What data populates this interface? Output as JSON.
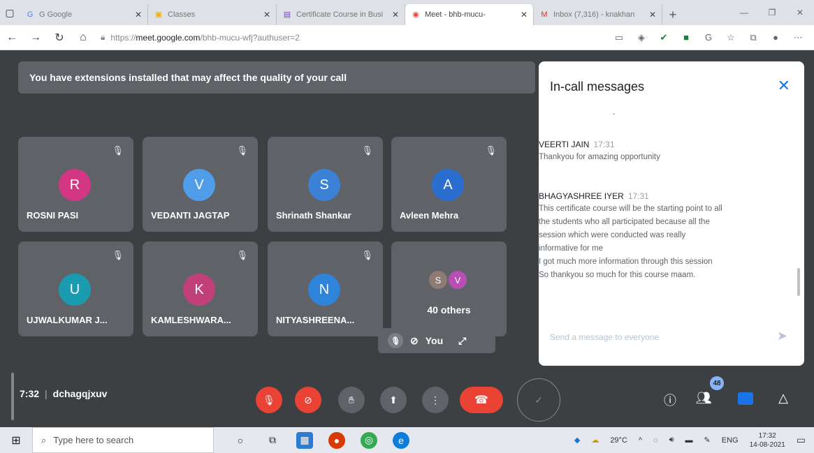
{
  "browser": {
    "tabs": [
      {
        "title": "G Google",
        "icon": "google-icon",
        "active": false
      },
      {
        "title": "Classes",
        "icon": "classroom-icon",
        "active": false
      },
      {
        "title": "Certificate Course in Busi",
        "icon": "forms-icon",
        "active": false
      },
      {
        "title": "Meet - bhb-mucu-",
        "icon": "meet-icon",
        "active": true
      },
      {
        "title": "Inbox (7,316) - knakhan",
        "icon": "gmail-icon",
        "active": false
      }
    ],
    "url_prefix": "https://",
    "url_host": "meet.google.com",
    "url_path": "/bhb-mucu-wfj?authuser=2"
  },
  "meet": {
    "banner": "You have extensions installed that may affect the quality of your call",
    "participants": [
      {
        "initial": "R",
        "name": "ROSNI PASI",
        "color": "#d33682"
      },
      {
        "initial": "V",
        "name": "VEDANTI JAGTAP",
        "color": "#4f9de8"
      },
      {
        "initial": "S",
        "name": "Shrinath Shankar",
        "color": "#3b82d6"
      },
      {
        "initial": "A",
        "name": "Avleen Mehra",
        "color": "#2a6fd0"
      },
      {
        "initial": "U",
        "name": "UJWALKUMAR J...",
        "color": "#1a9bb0"
      },
      {
        "initial": "K",
        "name": "KAMLESHWARA...",
        "color": "#c2407a"
      },
      {
        "initial": "N",
        "name": "NITYASHREENA...",
        "color": "#2d84d8"
      }
    ],
    "others": {
      "label": "40 others",
      "avatars": [
        {
          "initial": "S",
          "color": "#8d7b74"
        },
        {
          "initial": "V",
          "color": "#b84fb5"
        }
      ]
    },
    "self_label": "You",
    "time": "7:32",
    "meeting_code": "dchagqjxuv",
    "people_count": "48"
  },
  "chat": {
    "title": "In-call messages",
    "messages": [
      {
        "sender": "VEERTI JAIN",
        "time": "17:31",
        "text": "Thankyou for amazing opportunity"
      },
      {
        "sender": "BHAGYASHREE IYER",
        "time": "17:31",
        "lines": [
          "This certificate course will be the starting point to all",
          "the students who all participated because all the",
          "session which were conducted was really",
          "informative for me",
          "I got much more information through this session",
          "So thankyou so much for this course maam."
        ]
      }
    ],
    "compose_placeholder": "Send a message to everyone"
  },
  "taskbar": {
    "search_placeholder": "Type here to search",
    "temperature": "29°C",
    "language": "ENG",
    "clock_time": "17:32",
    "clock_date": "14-08-2021"
  }
}
